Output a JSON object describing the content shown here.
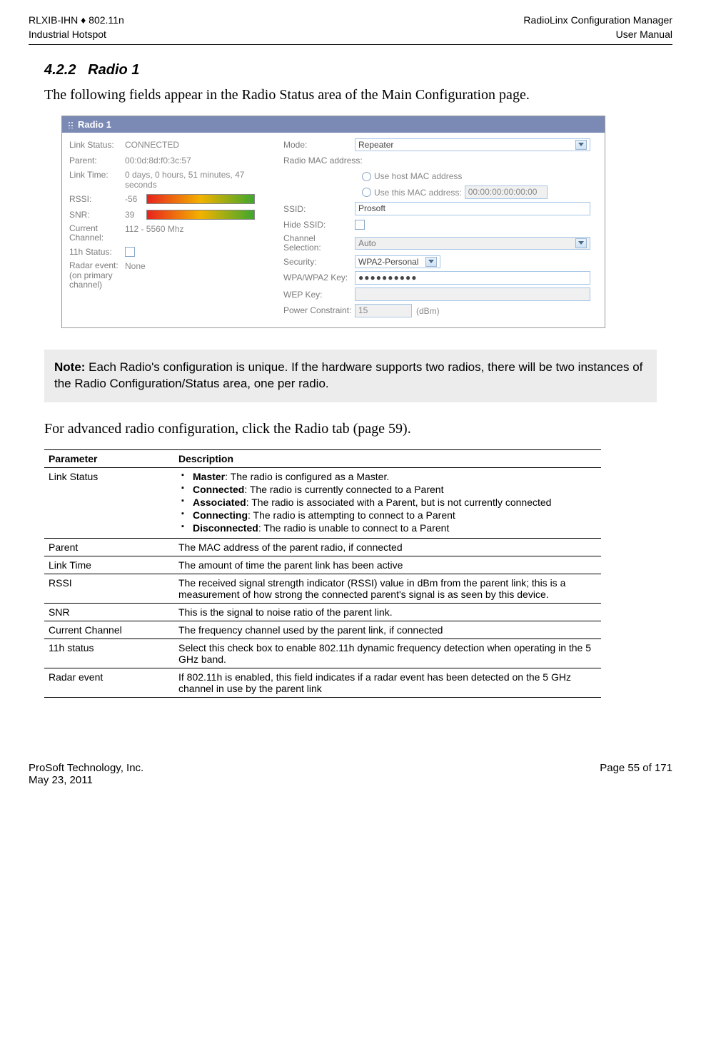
{
  "header": {
    "left1": "RLXIB-IHN ♦ 802.11n",
    "left2": "Industrial Hotspot",
    "right1": "RadioLinx Configuration Manager",
    "right2": "User Manual"
  },
  "section": {
    "number": "4.2.2",
    "title": "Radio 1",
    "intro": "The following fields appear in the Radio Status area of the Main Configuration page."
  },
  "screenshot": {
    "panel_title": "Radio 1",
    "left": {
      "link_status_label": "Link Status:",
      "link_status_value": "CONNECTED",
      "parent_label": "Parent:",
      "parent_value": "00:0d:8d:f0:3c:57",
      "link_time_label": "Link Time:",
      "link_time_value": "0 days, 0 hours, 51 minutes, 47 seconds",
      "rssi_label": "RSSI:",
      "rssi_value": "-56",
      "snr_label": "SNR:",
      "snr_value": "39",
      "curchan_label": "Current Channel:",
      "curchan_value": "112 - 5560 Mhz",
      "eleven_h_label": "11h Status:",
      "radar_label": "Radar event: (on primary channel)",
      "radar_value": "None"
    },
    "right": {
      "mode_label": "Mode:",
      "mode_value": "Repeater",
      "radio_mac_label": "Radio MAC address:",
      "mac_opt1": "Use host MAC address",
      "mac_opt2": "Use this MAC address:",
      "mac_value": "00:00:00:00:00:00",
      "ssid_label": "SSID:",
      "ssid_value": "Prosoft",
      "hide_ssid_label": "Hide SSID:",
      "chan_sel_label": "Channel Selection:",
      "chan_sel_value": "Auto",
      "security_label": "Security:",
      "security_value": "WPA2-Personal",
      "wpa_key_label": "WPA/WPA2 Key:",
      "wpa_key_value": "●●●●●●●●●●",
      "wep_key_label": "WEP Key:",
      "power_label": "Power Constraint:",
      "power_value": "15",
      "power_unit": "(dBm)"
    }
  },
  "note": {
    "prefix": "Note:",
    "text": " Each Radio's configuration is unique. If the hardware supports two radios, there will be two instances of the Radio Configuration/Status area, one per radio."
  },
  "advanced_text": "For advanced radio configuration, click the Radio tab (page 59).",
  "table": {
    "head_param": "Parameter",
    "head_desc": "Description",
    "rows": [
      {
        "param": "Link Status",
        "list": [
          {
            "b": "Master",
            "t": ": The radio is configured as a Master."
          },
          {
            "b": "Connected",
            "t": ": The radio is currently connected to a Parent"
          },
          {
            "b": "Associated",
            "t": ": The radio is associated with a Parent, but is not currently connected"
          },
          {
            "b": "Connecting",
            "t": ": The radio is attempting to connect to a Parent"
          },
          {
            "b": "Disconnected",
            "t": ": The radio is unable to connect to a Parent"
          }
        ]
      },
      {
        "param": "Parent",
        "desc": "The MAC address of the parent radio, if connected"
      },
      {
        "param": "Link Time",
        "desc": "The amount of time the parent link has been active"
      },
      {
        "param": "RSSI",
        "desc": "The received signal strength indicator (RSSI) value in dBm from the parent link; this is a measurement of how strong the connected parent's signal is as seen by this device."
      },
      {
        "param": "SNR",
        "desc": "This is the signal to noise ratio of the parent link."
      },
      {
        "param": "Current Channel",
        "desc": "The frequency channel used by the parent link, if connected"
      },
      {
        "param": "11h status",
        "desc": "Select this check box to enable 802.11h dynamic frequency detection when operating in the 5 GHz band."
      },
      {
        "param": "Radar event",
        "desc": "If 802.11h is enabled, this field indicates if a radar event has been detected on the 5 GHz channel in use by the parent link"
      }
    ]
  },
  "footer": {
    "left1": "ProSoft Technology, Inc.",
    "left2": "May 23, 2011",
    "right": "Page 55 of 171"
  }
}
